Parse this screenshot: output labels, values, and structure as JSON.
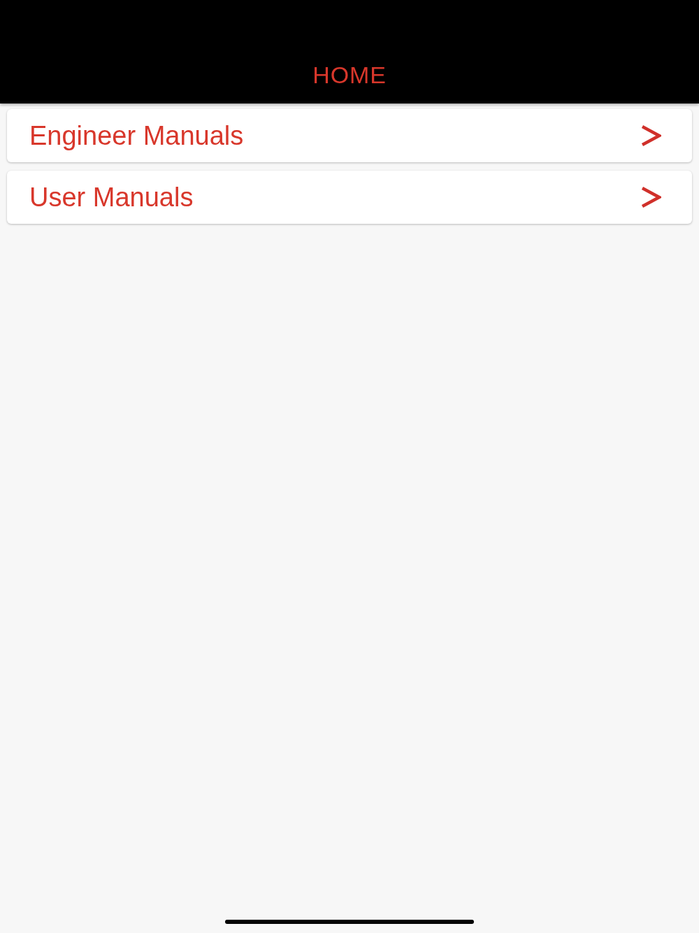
{
  "header": {
    "title": "HOME"
  },
  "menu": [
    {
      "label": "Engineer Manuals"
    },
    {
      "label": "User Manuals"
    }
  ]
}
